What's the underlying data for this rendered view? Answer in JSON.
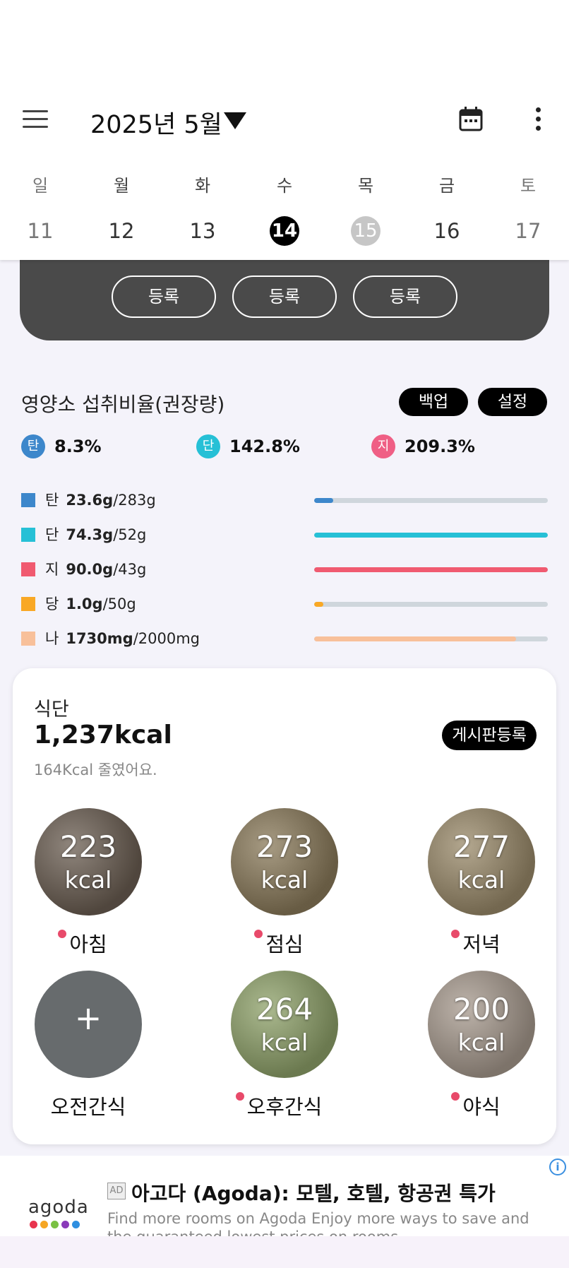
{
  "header": {
    "month_title": "2025년 5월",
    "menu_icon": "hamburger-menu-icon",
    "dropdown_icon": "triangle-down-icon",
    "calendar_icon": "calendar-icon",
    "more_icon": "more-vert-icon"
  },
  "week": [
    {
      "weekday": "일",
      "date": "11",
      "state": "weekend"
    },
    {
      "weekday": "월",
      "date": "12",
      "state": "normal"
    },
    {
      "weekday": "화",
      "date": "13",
      "state": "normal"
    },
    {
      "weekday": "수",
      "date": "14",
      "state": "selected"
    },
    {
      "weekday": "목",
      "date": "15",
      "state": "today"
    },
    {
      "weekday": "금",
      "date": "16",
      "state": "normal"
    },
    {
      "weekday": "토",
      "date": "17",
      "state": "weekend"
    }
  ],
  "register": {
    "labels": [
      "등록",
      "등록",
      "등록"
    ]
  },
  "nutrition": {
    "title": "영양소 섭취비율(권장량)",
    "backup_label": "백업",
    "settings_label": "설정",
    "ratios": [
      {
        "badge": "탄",
        "value": "8.3%",
        "color": "#3d87cb"
      },
      {
        "badge": "단",
        "value": "142.8%",
        "color": "#26c0d6"
      },
      {
        "badge": "지",
        "value": "209.3%",
        "color": "#ef5f85"
      }
    ],
    "rows": [
      {
        "label": "탄",
        "amount": "23.6g",
        "target": "/283g",
        "color": "#3d87cb",
        "fill": 0.083
      },
      {
        "label": "단",
        "amount": "74.3g",
        "target": "/52g",
        "color": "#26c0d6",
        "fill": 1.0
      },
      {
        "label": "지",
        "amount": "90.0g",
        "target": "/43g",
        "color": "#f05a70",
        "fill": 1.0
      },
      {
        "label": "당",
        "amount": "1.0g",
        "target": "/50g",
        "color": "#f9a825",
        "fill": 0.04
      },
      {
        "label": "나",
        "amount": "1730mg",
        "target": "/2000mg",
        "color": "#f8c09a",
        "fill": 0.865
      }
    ]
  },
  "diet": {
    "heading": "식단",
    "total_kcal": "1,237kcal",
    "note": "164Kcal 줄였어요.",
    "board_button": "게시판등록",
    "meals": [
      {
        "label": "아침",
        "kcal": "223",
        "unit": "kcal",
        "dot": true,
        "empty": false,
        "photo": "coffee-latte",
        "bg": "#6b5e52"
      },
      {
        "label": "점심",
        "kcal": "273",
        "unit": "kcal",
        "dot": true,
        "empty": false,
        "photo": "rice-vegetables",
        "bg": "#8a7a5a"
      },
      {
        "label": "저녁",
        "kcal": "277",
        "unit": "kcal",
        "dot": true,
        "empty": false,
        "photo": "potatoes-tomatoes",
        "bg": "#9a8a6a"
      },
      {
        "label": "오전간식",
        "kcal": "+",
        "unit": "",
        "dot": false,
        "empty": true,
        "photo": "",
        "bg": "#676b6d"
      },
      {
        "label": "오후간식",
        "kcal": "264",
        "unit": "kcal",
        "dot": true,
        "empty": false,
        "photo": "green-tea-latte",
        "bg": "#8fa26a"
      },
      {
        "label": "야식",
        "kcal": "200",
        "unit": "kcal",
        "dot": true,
        "empty": false,
        "photo": "cappuccino-floral-cup",
        "bg": "#a79a8e"
      }
    ]
  },
  "ad": {
    "badge": "AD",
    "logo_text": "agoda",
    "title": "아고다 (Agoda): 모텔, 호텔, 항공권 특가",
    "description": "Find more rooms on Agoda Enjoy more ways to save and the guaranteed lowest prices on rooms",
    "info_icon": "info-icon",
    "logo_dot_colors": [
      "#e8344e",
      "#f5a623",
      "#7ac143",
      "#8a3ab9",
      "#2f8fe0"
    ]
  }
}
